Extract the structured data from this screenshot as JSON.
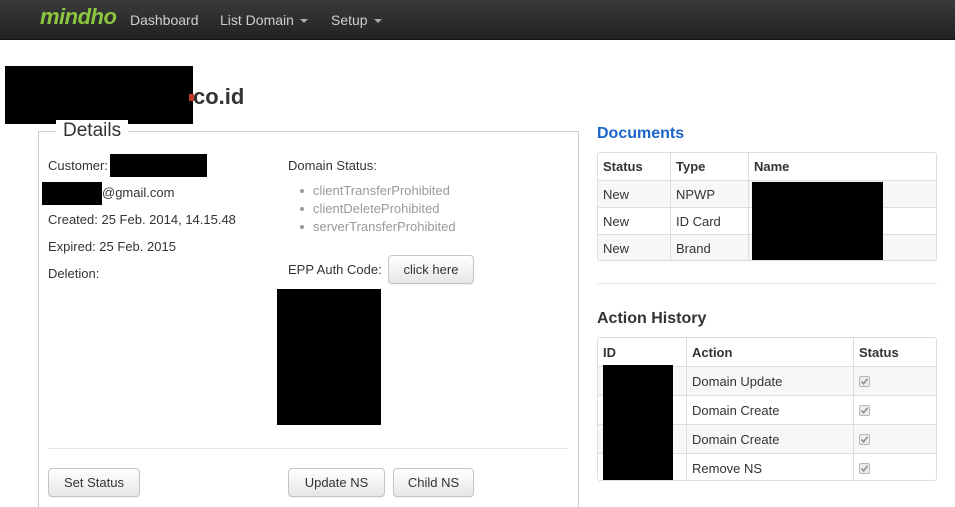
{
  "navbar": {
    "brand": "mindho",
    "items": [
      {
        "label": "Dashboard",
        "dropdown": false
      },
      {
        "label": "List Domain",
        "dropdown": true
      },
      {
        "label": "Setup",
        "dropdown": true
      }
    ]
  },
  "domain": {
    "title_suffix": "co.id"
  },
  "details": {
    "legend": "Details",
    "customer_label": "Customer:",
    "email_suffix": "@gmail.com",
    "created": "Created: 25 Feb. 2014, 14.15.48",
    "expired": "Expired: 25 Feb. 2015",
    "deletion": "Deletion:",
    "domain_status_label": "Domain Status:",
    "domain_statuses": [
      "clientTransferProhibited",
      "clientDeleteProhibited",
      "serverTransferProhibited"
    ],
    "epp_label": "EPP Auth Code:",
    "epp_button": "click here",
    "buttons": {
      "set_status": "Set Status",
      "update_ns": "Update NS",
      "child_ns": "Child NS"
    }
  },
  "documents": {
    "title": "Documents",
    "title_color": "#1a66c8",
    "headers": [
      "Status",
      "Type",
      "Name"
    ],
    "rows": [
      {
        "status": "New",
        "type": "NPWP"
      },
      {
        "status": "New",
        "type": "ID Card"
      },
      {
        "status": "New",
        "type": "Brand"
      }
    ]
  },
  "action_history": {
    "title": "Action History",
    "headers": [
      "ID",
      "Action",
      "Status"
    ],
    "rows": [
      {
        "action": "Domain Update",
        "checked": true
      },
      {
        "action": "Domain Create",
        "checked": true
      },
      {
        "action": "Domain Create",
        "checked": true
      },
      {
        "action": "Remove NS",
        "checked": true
      }
    ]
  },
  "colors": {
    "brand": "#8cc63f",
    "navbar": "#2b2b2b",
    "muted_text": "#999999"
  }
}
